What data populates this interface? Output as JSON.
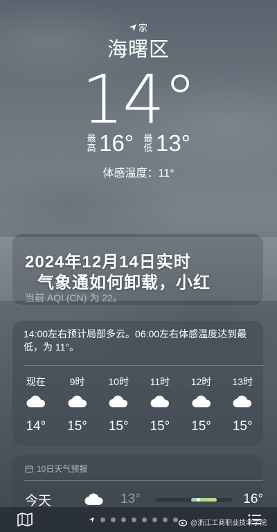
{
  "header": {
    "location_label": "家",
    "city": "海曙区",
    "temperature": "14°",
    "high_label": "最高",
    "high": "16°",
    "low_label": "最低",
    "low": "13°",
    "feels_like": "体感温度：11°"
  },
  "overlay": {
    "line1": "2024年12月14日实时",
    "line2": "气象通如何卸载，小红"
  },
  "aqi": {
    "text": "当前 AQI (CN) 为 22。"
  },
  "hourly": {
    "summary": "14:00左右预计局部多云。06:00左右体感温度达到最低，为 11°。",
    "items": [
      {
        "time": "现在",
        "icon": "cloud-icon",
        "temp": "14°"
      },
      {
        "time": "9时",
        "icon": "cloud-icon",
        "temp": "15°"
      },
      {
        "time": "10时",
        "icon": "cloud-icon",
        "temp": "15°"
      },
      {
        "time": "11时",
        "icon": "cloud-icon",
        "temp": "15°"
      },
      {
        "time": "12时",
        "icon": "cloud-icon",
        "temp": "15°"
      },
      {
        "time": "13时",
        "icon": "cloud-icon",
        "temp": "15°"
      }
    ]
  },
  "daily": {
    "header": "10日天气预报",
    "rows": [
      {
        "day": "今天",
        "icon": "cloud-icon",
        "low": "13°",
        "high": "16°",
        "range_start": 0.45,
        "range_end": 0.78,
        "current": 0.55
      }
    ]
  },
  "bottom_bar": {
    "map_icon": "map-icon",
    "list_icon": "list-icon",
    "page_count": 8
  },
  "watermark": {
    "text": "@浙江工商职业技术学院"
  }
}
